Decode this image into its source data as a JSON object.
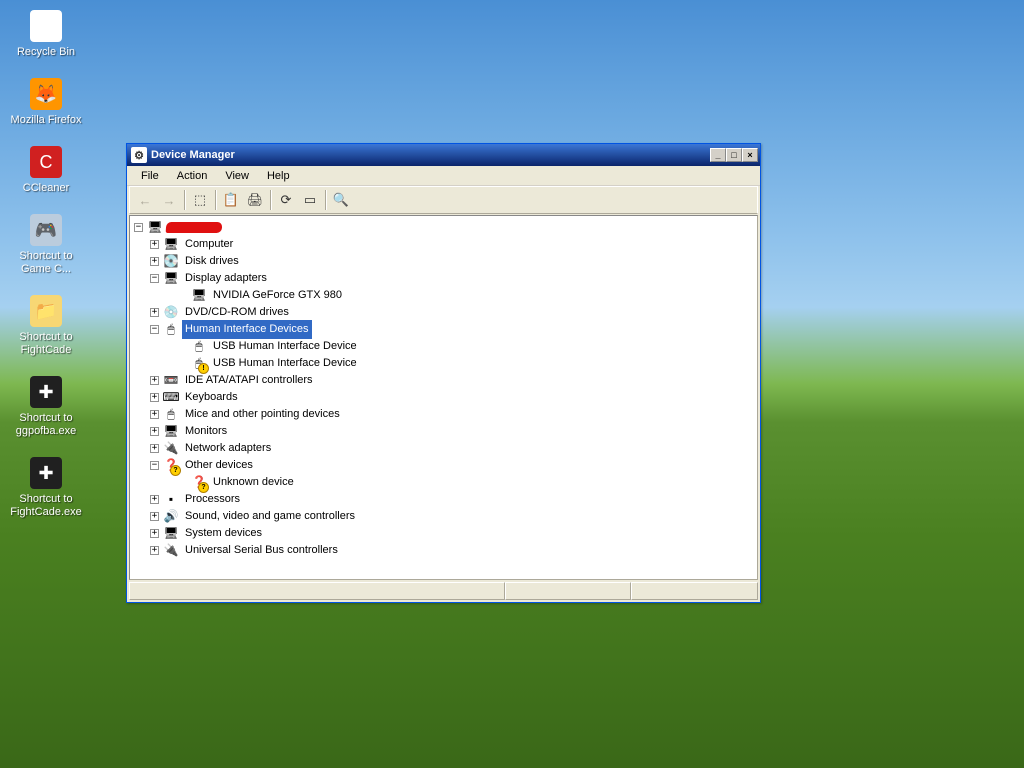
{
  "desktop_icons": [
    {
      "label": "Recycle Bin",
      "glyph": "🗑",
      "bg": "#fff"
    },
    {
      "label": "Mozilla Firefox",
      "glyph": "🦊",
      "bg": "#ff9500"
    },
    {
      "label": "CCleaner",
      "glyph": "C",
      "bg": "#d02020"
    },
    {
      "label": "Shortcut to Game C...",
      "glyph": "🎮",
      "bg": "#bcd"
    },
    {
      "label": "Shortcut to FightCade",
      "glyph": "📁",
      "bg": "#f7d774"
    },
    {
      "label": "Shortcut to ggpofba.exe",
      "glyph": "✚",
      "bg": "#202020"
    },
    {
      "label": "Shortcut to FightCade.exe",
      "glyph": "✚",
      "bg": "#202020"
    }
  ],
  "window": {
    "title": "Device Manager",
    "menu": [
      "File",
      "Action",
      "View",
      "Help"
    ],
    "toolbar": [
      {
        "name": "back",
        "glyph": "←",
        "disabled": true
      },
      {
        "name": "forward",
        "glyph": "→",
        "disabled": true
      },
      {
        "name": "sep"
      },
      {
        "name": "up",
        "glyph": "⬚"
      },
      {
        "name": "sep"
      },
      {
        "name": "properties",
        "glyph": "📋"
      },
      {
        "name": "print",
        "glyph": "🖨"
      },
      {
        "name": "sep"
      },
      {
        "name": "refresh",
        "glyph": "⟳"
      },
      {
        "name": "showhidden",
        "glyph": "▭"
      },
      {
        "name": "sep"
      },
      {
        "name": "scan",
        "glyph": "🔍"
      }
    ]
  },
  "tree": {
    "root": {
      "label": "(redacted)",
      "icon": "🖥",
      "expanded": true
    },
    "nodes": [
      {
        "exp": "+",
        "icon": "🖥",
        "label": "Computer",
        "depth": 1
      },
      {
        "exp": "+",
        "icon": "💽",
        "label": "Disk drives",
        "depth": 1
      },
      {
        "exp": "-",
        "icon": "🖥",
        "label": "Display adapters",
        "depth": 1
      },
      {
        "exp": "",
        "icon": "🖥",
        "label": "NVIDIA GeForce GTX 980",
        "depth": 2,
        "last": true
      },
      {
        "exp": "+",
        "icon": "💿",
        "label": "DVD/CD-ROM drives",
        "depth": 1
      },
      {
        "exp": "-",
        "icon": "🖱",
        "label": "Human Interface Devices",
        "depth": 1,
        "selected": true
      },
      {
        "exp": "",
        "icon": "🖱",
        "label": "USB Human Interface Device",
        "depth": 2
      },
      {
        "exp": "",
        "icon": "🖱",
        "label": "USB Human Interface Device",
        "depth": 2,
        "last": true,
        "warn": true
      },
      {
        "exp": "+",
        "icon": "📼",
        "label": "IDE ATA/ATAPI controllers",
        "depth": 1
      },
      {
        "exp": "+",
        "icon": "⌨",
        "label": "Keyboards",
        "depth": 1
      },
      {
        "exp": "+",
        "icon": "🖱",
        "label": "Mice and other pointing devices",
        "depth": 1
      },
      {
        "exp": "+",
        "icon": "🖥",
        "label": "Monitors",
        "depth": 1
      },
      {
        "exp": "+",
        "icon": "🔌",
        "label": "Network adapters",
        "depth": 1
      },
      {
        "exp": "-",
        "icon": "❓",
        "label": "Other devices",
        "depth": 1,
        "q": true
      },
      {
        "exp": "",
        "icon": "❓",
        "label": "Unknown device",
        "depth": 2,
        "last": true,
        "q": true
      },
      {
        "exp": "+",
        "icon": "▪",
        "label": "Processors",
        "depth": 1
      },
      {
        "exp": "+",
        "icon": "🔊",
        "label": "Sound, video and game controllers",
        "depth": 1
      },
      {
        "exp": "+",
        "icon": "🖥",
        "label": "System devices",
        "depth": 1
      },
      {
        "exp": "+",
        "icon": "🔌",
        "label": "Universal Serial Bus controllers",
        "depth": 1,
        "lastTop": true
      }
    ]
  }
}
